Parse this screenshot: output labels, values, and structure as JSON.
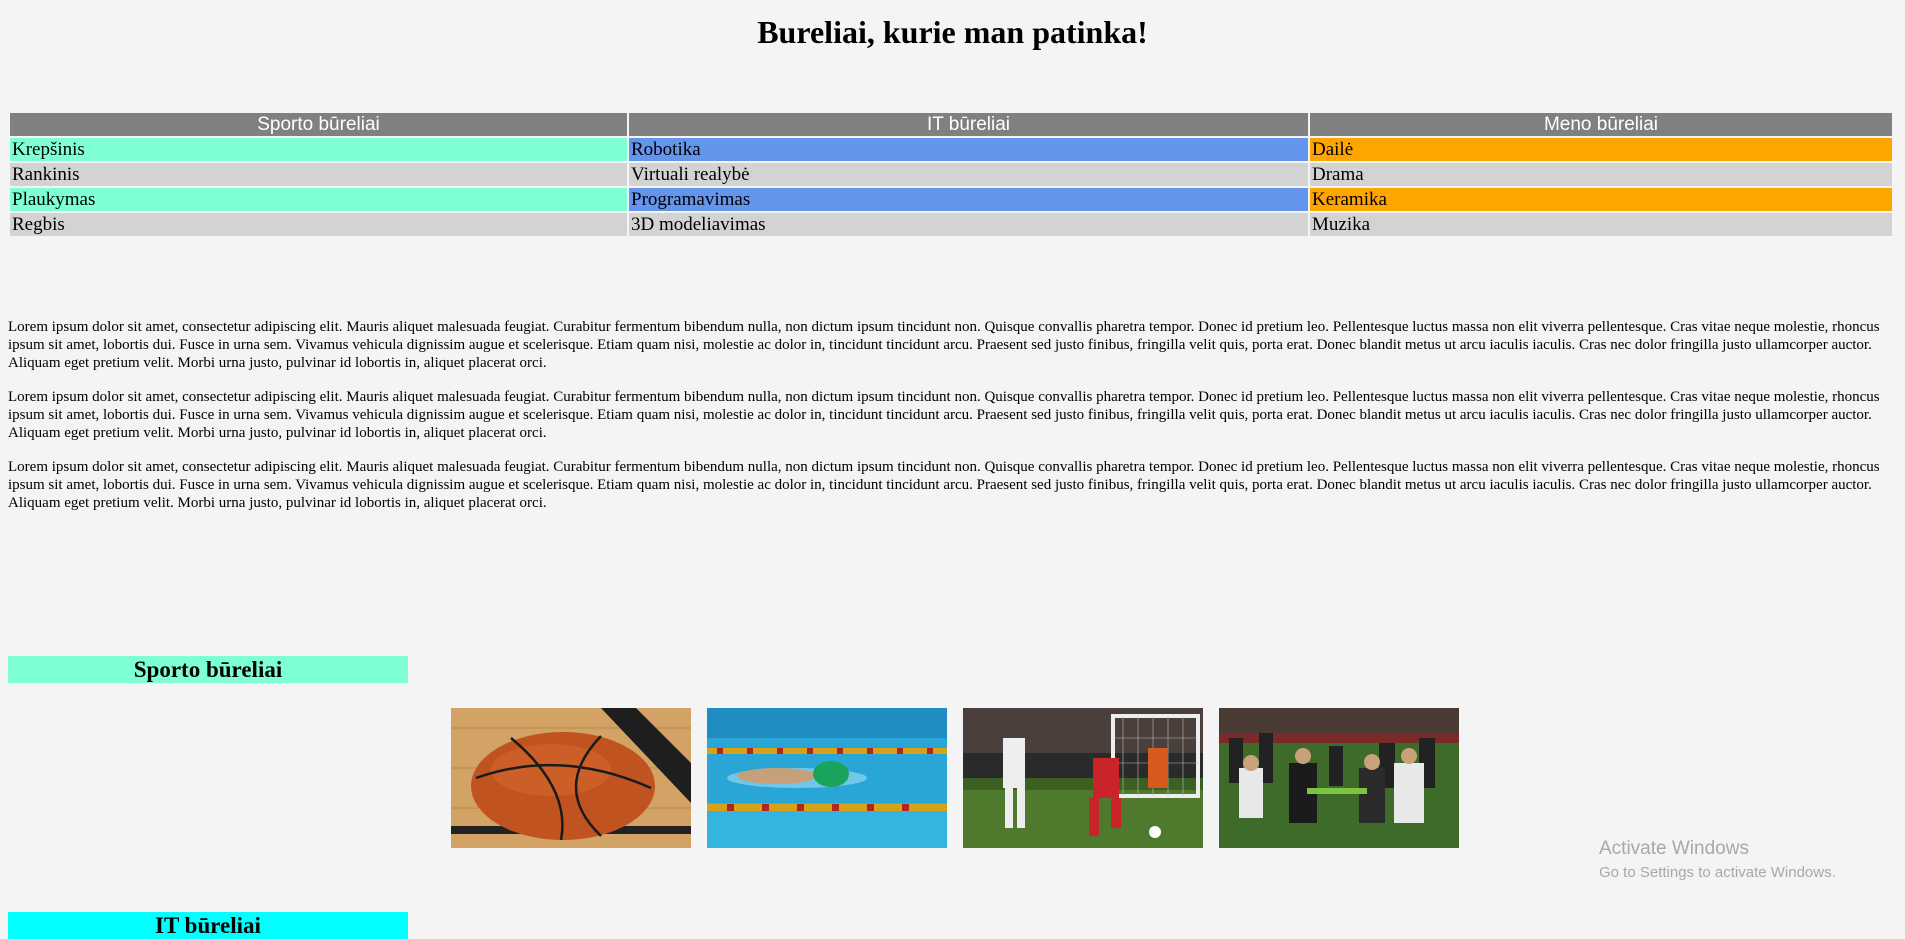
{
  "page_title": "Bureliai, kurie man patinka!",
  "table": {
    "headers": [
      "Sporto būreliai",
      "IT būreliai",
      "Meno būreliai"
    ],
    "rows": [
      [
        "Krepšinis",
        "Robotika",
        "Dailė"
      ],
      [
        "Rankinis",
        "Virtuali realybė",
        "Drama"
      ],
      [
        "Plaukymas",
        "Programavimas",
        "Keramika"
      ],
      [
        "Regbis",
        "3D modeliavimas",
        "Muzika"
      ]
    ]
  },
  "paragraphs": [
    "Lorem ipsum dolor sit amet, consectetur adipiscing elit. Mauris aliquet malesuada feugiat. Curabitur fermentum bibendum nulla, non dictum ipsum tincidunt non. Quisque convallis pharetra tempor. Donec id pretium leo. Pellentesque luctus massa non elit viverra pellentesque. Cras vitae neque molestie, rhoncus ipsum sit amet, lobortis dui. Fusce in urna sem. Vivamus vehicula dignissim augue et scelerisque. Etiam quam nisi, molestie ac dolor in, tincidunt tincidunt arcu. Praesent sed justo finibus, fringilla velit quis, porta erat. Donec blandit metus ut arcu iaculis iaculis. Cras nec dolor fringilla justo ullamcorper auctor. Aliquam eget pretium velit. Morbi urna justo, pulvinar id lobortis in, aliquet placerat orci.",
    "Lorem ipsum dolor sit amet, consectetur adipiscing elit. Mauris aliquet malesuada feugiat. Curabitur fermentum bibendum nulla, non dictum ipsum tincidunt non. Quisque convallis pharetra tempor. Donec id pretium leo. Pellentesque luctus massa non elit viverra pellentesque. Cras vitae neque molestie, rhoncus ipsum sit amet, lobortis dui. Fusce in urna sem. Vivamus vehicula dignissim augue et scelerisque. Etiam quam nisi, molestie ac dolor in, tincidunt tincidunt arcu. Praesent sed justo finibus, fringilla velit quis, porta erat. Donec blandit metus ut arcu iaculis iaculis. Cras nec dolor fringilla justo ullamcorper auctor. Aliquam eget pretium velit. Morbi urna justo, pulvinar id lobortis in, aliquet placerat orci.",
    "Lorem ipsum dolor sit amet, consectetur adipiscing elit. Mauris aliquet malesuada feugiat. Curabitur fermentum bibendum nulla, non dictum ipsum tincidunt non. Quisque convallis pharetra tempor. Donec id pretium leo. Pellentesque luctus massa non elit viverra pellentesque. Cras vitae neque molestie, rhoncus ipsum sit amet, lobortis dui. Fusce in urna sem. Vivamus vehicula dignissim augue et scelerisque. Etiam quam nisi, molestie ac dolor in, tincidunt tincidunt arcu. Praesent sed justo finibus, fringilla velit quis, porta erat. Donec blandit metus ut arcu iaculis iaculis. Cras nec dolor fringilla justo ullamcorper auctor. Aliquam eget pretium velit. Morbi urna justo, pulvinar id lobortis in, aliquet placerat orci."
  ],
  "sections": {
    "sport_heading": "Sporto būreliai",
    "it_heading": "IT būreliai"
  },
  "photos": [
    "basketball-photo",
    "swimming-photo",
    "soccer-photo",
    "rugby-photo"
  ],
  "watermark": {
    "line1": "Activate Windows",
    "line2": "Go to Settings to activate Windows."
  },
  "colors": {
    "sport": "#7fffd4",
    "it": "#6495ed",
    "art": "#ffa500",
    "grey_row": "#d3d3d3",
    "header": "#808080",
    "it_heading": "#00ffff"
  }
}
